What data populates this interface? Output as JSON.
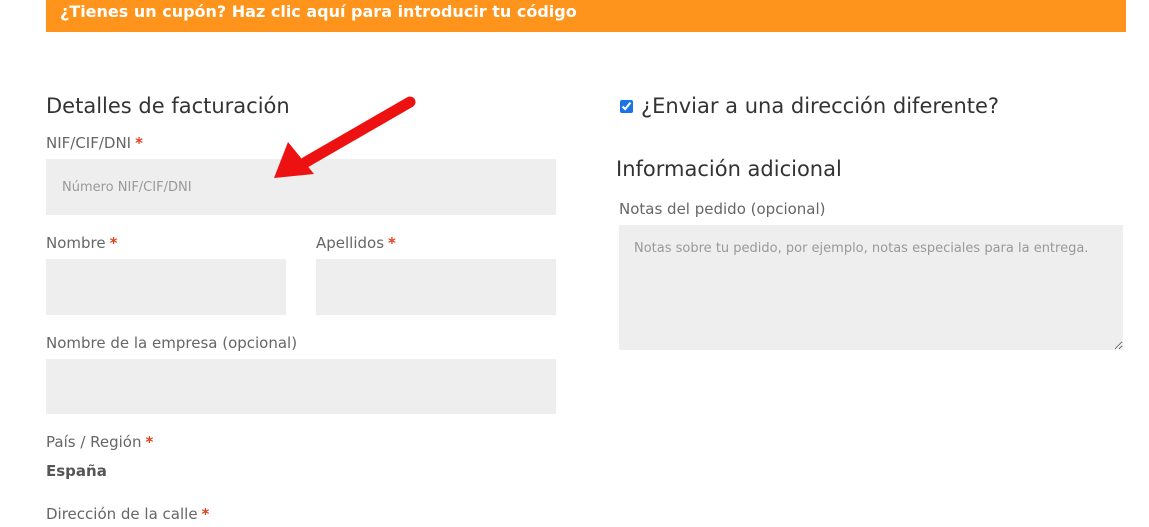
{
  "coupon": {
    "text": "¿Tienes un cupón? Haz clic aquí para introducir tu código"
  },
  "billing": {
    "title": "Detalles de facturación",
    "nif_label": "NIF/CIF/DNI",
    "nif_placeholder": "Número NIF/CIF/DNI",
    "first_name_label": "Nombre",
    "last_name_label": "Apellidos",
    "company_label": "Nombre de la empresa (opcional)",
    "country_label": "País / Región",
    "country_value": "España",
    "street_label": "Dirección de la calle",
    "required_mark": "*"
  },
  "shipping": {
    "ship_different_label": "¿Enviar a una dirección diferente?",
    "ship_different_checked": true
  },
  "additional": {
    "title": "Información adicional",
    "notes_label": "Notas del pedido (opcional)",
    "notes_placeholder": "Notas sobre tu pedido, por ejemplo, notas especiales para la entrega."
  },
  "colors": {
    "accent": "#ff941c",
    "required": "#e2401c",
    "field_bg": "#eeeeee",
    "arrow": "#ee1111"
  },
  "icons": {
    "annotation": "red-arrow-icon"
  }
}
